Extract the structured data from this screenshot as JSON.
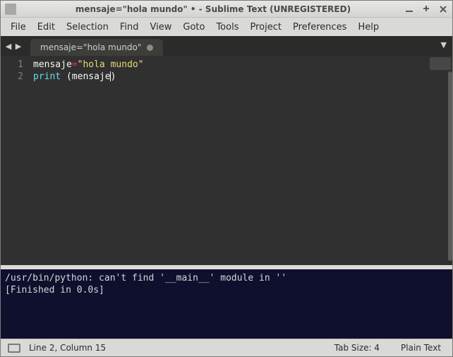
{
  "window": {
    "title": "mensaje=\"hola mundo\" • - Sublime Text (UNREGISTERED)"
  },
  "menu": {
    "file": "File",
    "edit": "Edit",
    "selection": "Selection",
    "find": "Find",
    "view": "View",
    "goto": "Goto",
    "tools": "Tools",
    "project": "Project",
    "preferences": "Preferences",
    "help": "Help"
  },
  "tab": {
    "label": "mensaje=\"hola mundo\""
  },
  "code": {
    "line1": {
      "var": "mensaje",
      "op": "=",
      "str": "\"hola mundo\""
    },
    "line2": {
      "fn": "print",
      "sp_lparen": " (",
      "arg": "mensaje",
      "rparen": ")"
    },
    "gutter": {
      "l1": "1",
      "l2": "2"
    }
  },
  "console": {
    "line1": "/usr/bin/python: can't find '__main__' module in ''",
    "line2": "[Finished in 0.0s]"
  },
  "status": {
    "position": "Line 2, Column 15",
    "tabsize": "Tab Size: 4",
    "syntax": "Plain Text"
  }
}
